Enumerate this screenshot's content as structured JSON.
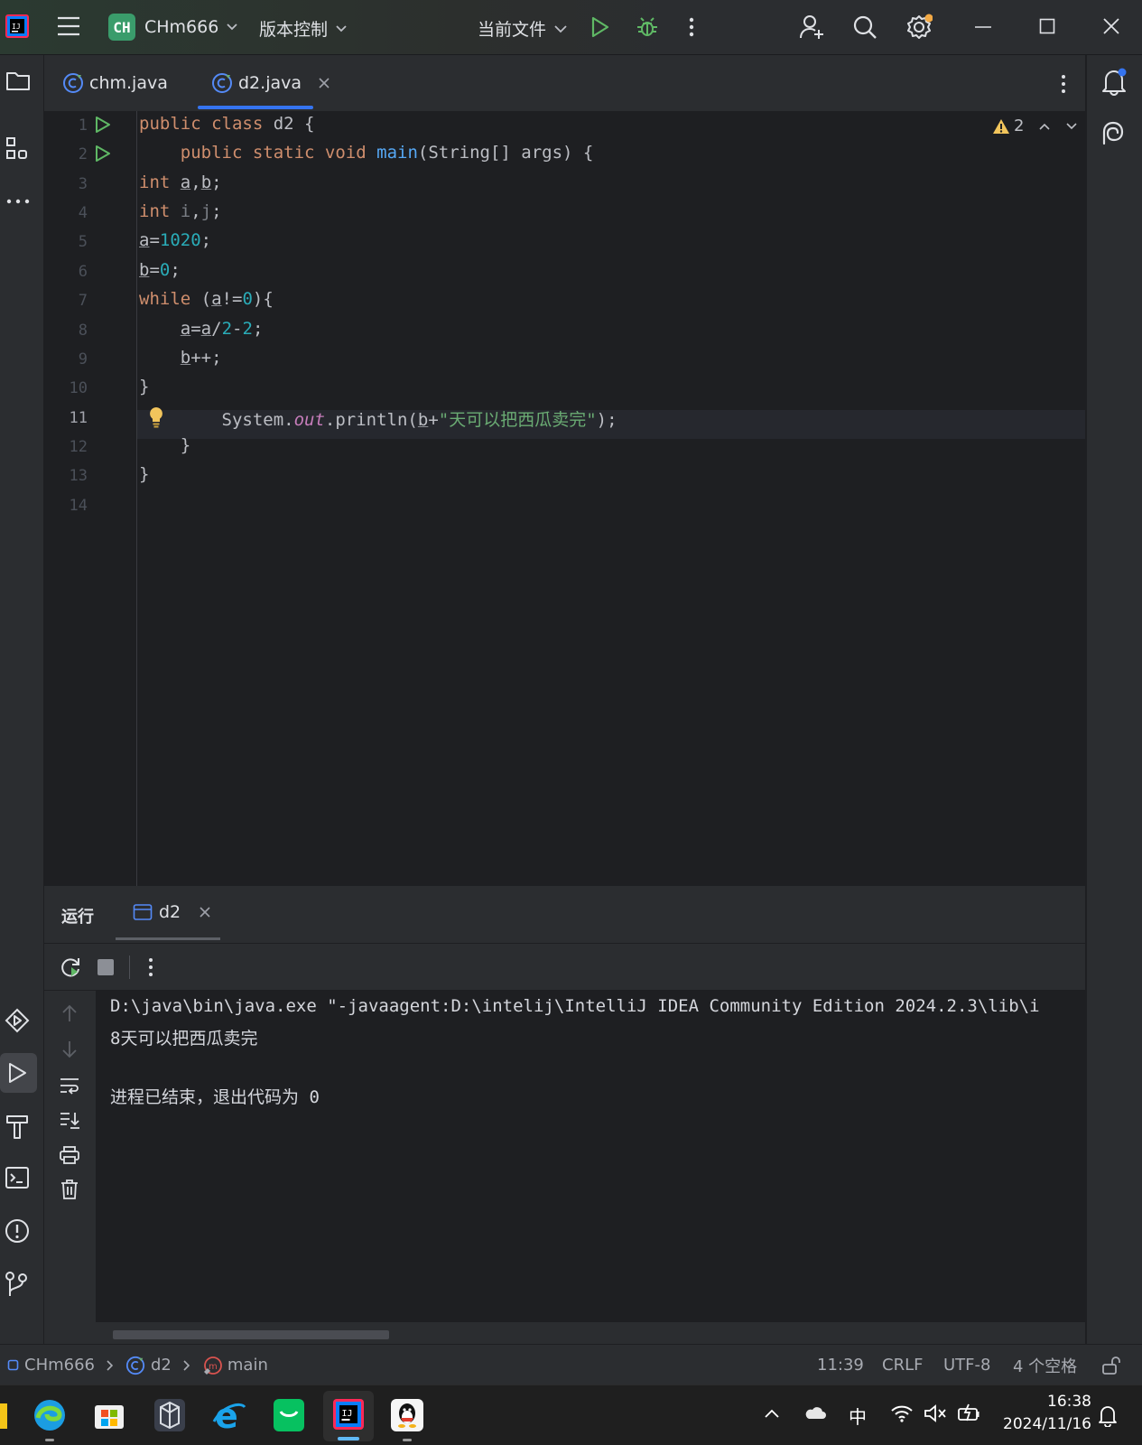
{
  "title_bar": {
    "project_badge": "CH",
    "project_name": "CHm666",
    "vcs_menu": "版本控制",
    "run_config": "当前文件"
  },
  "tabs": [
    {
      "label": "chm.java",
      "active": false
    },
    {
      "label": "d2.java",
      "active": true
    }
  ],
  "inspection": {
    "warning_count": "2"
  },
  "editor": {
    "line_numbers": [
      "1",
      "2",
      "3",
      "4",
      "5",
      "6",
      "7",
      "8",
      "9",
      "10",
      "11",
      "12",
      "13",
      "14"
    ],
    "current_line": "11",
    "code": [
      {
        "kw1": "public class",
        "rest": " d2 {"
      },
      {
        "indent": "    ",
        "kw1": "public static void",
        "fn": "main",
        "rest": "(String[] args) {"
      },
      {
        "kw": "int",
        "v1": "a",
        "sep": ",",
        "v2": "b",
        "end": ";"
      },
      {
        "kw": "int",
        "v1": "i",
        "sep": ",",
        "v2": "j",
        "end": ";"
      },
      {
        "v": "a",
        "op": "=",
        "num": "1020",
        "end": ";"
      },
      {
        "v": "b",
        "op": "=",
        "num": "0",
        "end": ";"
      },
      {
        "kw": "while",
        "a": " (",
        "v": "a",
        "op": "!=",
        "num": "0",
        "end": "){"
      },
      {
        "indent": "    ",
        "v1": "a",
        "op1": "=",
        "v2": "a",
        "op2": "/",
        "n1": "2",
        "op3": "-",
        "n2": "2",
        "end": ";"
      },
      {
        "indent": "    ",
        "v": "b",
        "end": "++;"
      },
      {
        "text": "}"
      },
      {
        "indent": "        ",
        "p1": "System.",
        "fld": "out",
        "p2": ".println(",
        "v": "b",
        "op": "+",
        "str": "\"天可以把西瓜卖完\"",
        "end": ");"
      },
      {
        "text": "    }"
      },
      {
        "text": "}"
      },
      {
        "text": ""
      }
    ]
  },
  "run_panel": {
    "title": "运行",
    "tab": "d2",
    "console": [
      "D:\\java\\bin\\java.exe \"-javaagent:D:\\intelij\\IntelliJ IDEA Community Edition 2024.2.3\\lib\\i",
      "8天可以把西瓜卖完",
      "",
      "进程已结束，退出代码为 0"
    ]
  },
  "status_bar": {
    "breadcrumb": [
      "CHm666",
      "d2",
      "main"
    ],
    "position": "11:39",
    "line_sep": "CRLF",
    "encoding": "UTF-8",
    "indent": "4 个空格"
  },
  "taskbar": {
    "ime": "中",
    "time": "16:38",
    "date": "2024/11/16"
  },
  "colors": {
    "accent": "#3574f0",
    "keyword": "#cf8e6d",
    "number": "#2aacb8",
    "function": "#56a8f5",
    "string": "#6aab73",
    "run_green": "#5fb865",
    "warning": "#f2c55c"
  }
}
